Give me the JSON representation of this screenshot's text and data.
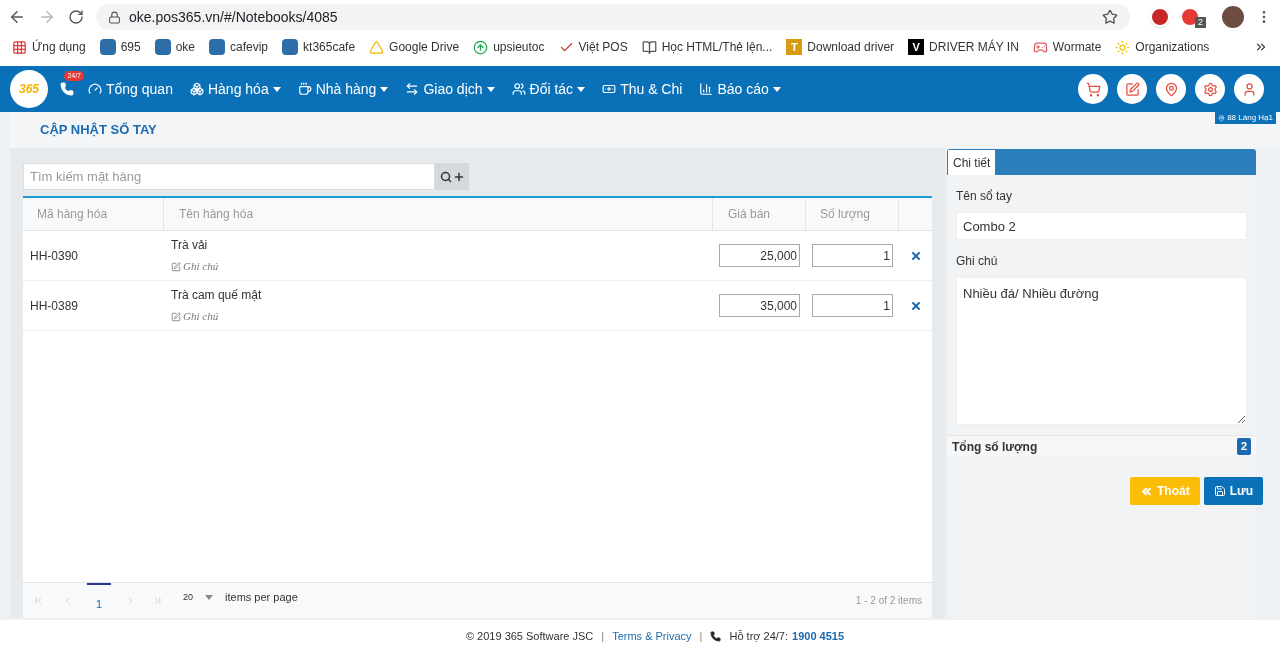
{
  "browser": {
    "url": "oke.pos365.vn/#/Notebooks/4085",
    "extension_badge": "2",
    "bookmarks": [
      {
        "label": "Ứng dụng",
        "kind": "apps"
      },
      {
        "label": "695",
        "kind": "pos"
      },
      {
        "label": "oke",
        "kind": "pos"
      },
      {
        "label": "cafevip",
        "kind": "pos"
      },
      {
        "label": "kt365cafe",
        "kind": "pos"
      },
      {
        "label": "Google Drive",
        "kind": "drive"
      },
      {
        "label": "upsieutoc",
        "kind": "upload"
      },
      {
        "label": "Việt POS",
        "kind": "check"
      },
      {
        "label": "Học HTML/Thẻ lện...",
        "kind": "books"
      },
      {
        "label": "Download driver",
        "kind": "letter",
        "letter": "T"
      },
      {
        "label": "DRIVER MÁY IN",
        "kind": "letter",
        "letter": "V"
      },
      {
        "label": "Wormate",
        "kind": "game"
      },
      {
        "label": "Organizations",
        "kind": "org"
      }
    ]
  },
  "nav": {
    "logo": "365",
    "phone_badge": "24/7",
    "branch": "88 Láng Hạ1",
    "menu": [
      {
        "label": "Tổng quan",
        "kind": "gauge",
        "dropdown": false
      },
      {
        "label": "Hàng hóa",
        "kind": "boxes",
        "dropdown": true
      },
      {
        "label": "Nhà hàng",
        "kind": "coffee",
        "dropdown": true
      },
      {
        "label": "Giao dịch",
        "kind": "exchange",
        "dropdown": true
      },
      {
        "label": "Đối tác",
        "kind": "users",
        "dropdown": true
      },
      {
        "label": "Thu & Chi",
        "kind": "money",
        "dropdown": false
      },
      {
        "label": "Báo cáo",
        "kind": "chart",
        "dropdown": true
      }
    ]
  },
  "page": {
    "title": "CẬP NHẬT SỔ TAY",
    "search": {
      "placeholder": "Tìm kiếm mặt hàng"
    },
    "table": {
      "columns": [
        "Mã hàng hóa",
        "Tên hàng hóa",
        "Giá bán",
        "Số lượng"
      ],
      "rows": [
        {
          "code": "HH-0390",
          "name": "Trà vải",
          "note": "Ghi chú",
          "price": "25,000",
          "quantity": "1"
        },
        {
          "code": "HH-0389",
          "name": "Trà cam quế mật",
          "note": "Ghi chú",
          "price": "35,000",
          "quantity": "1"
        }
      ]
    },
    "pagination": {
      "pages": [
        {
          "label": "1",
          "selected": true
        }
      ],
      "page_size": "20",
      "per_page_label": "items per page",
      "summary": "1 - 2 of 2 items"
    }
  },
  "detail": {
    "tabs": [
      {
        "label": "Chi tiết",
        "selected": true
      }
    ],
    "name_label": "Tên sổ tay",
    "name_value": "Combo 2",
    "note_label": "Ghi chú",
    "note_value": "Nhiều đá/ Nhiều đường",
    "total_label": "Tổng số lượng",
    "total_value": "2",
    "buttons": [
      {
        "label": "Thoát",
        "kind": "exit"
      },
      {
        "label": "Lưu",
        "kind": "save"
      }
    ]
  },
  "footer": {
    "copyright": "© 2019 365 Software JSC",
    "separators": [
      "|",
      "|"
    ],
    "terms": "Terms & Privacy",
    "support_label": "Hỗ trợ 24/7:",
    "support_phone": "1900 4515"
  }
}
